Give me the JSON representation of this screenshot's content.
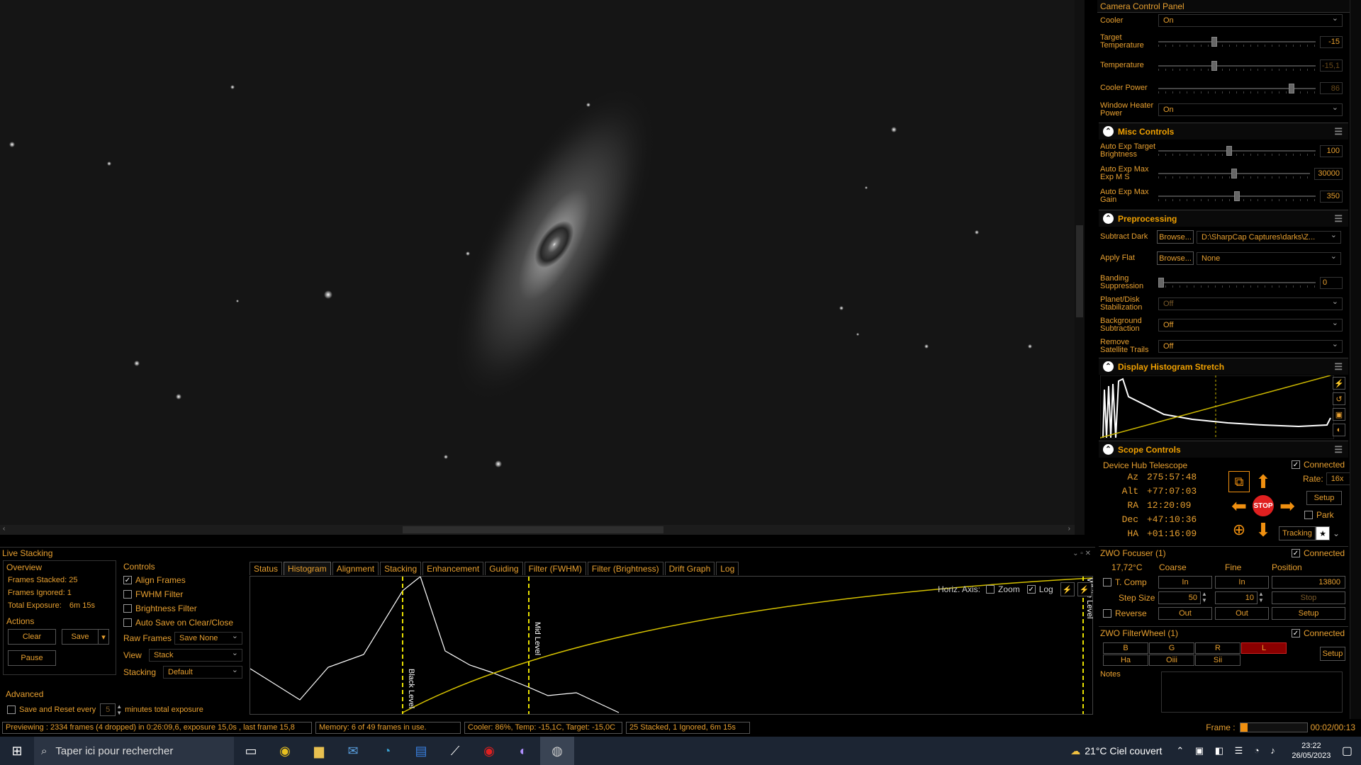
{
  "camera_panel": {
    "title": "Camera Control Panel",
    "cooler": {
      "label": "Cooler",
      "value": "On"
    },
    "target_temperature": {
      "label": "Target Temperature",
      "value": "-15",
      "level": 0.35
    },
    "temperature": {
      "label": "Temperature",
      "value": "-15,1",
      "level": 0.35
    },
    "cooler_power": {
      "label": "Cooler Power",
      "value": "86",
      "level": 0.86
    },
    "window_heater": {
      "label": "Window Heater Power",
      "value": "On"
    }
  },
  "misc_controls": {
    "title": "Misc Controls",
    "auto_exp_target": {
      "label": "Auto Exp Target Brightness",
      "value": "100",
      "level": 0.45
    },
    "auto_exp_max_ms": {
      "label": "Auto Exp Max Exp M S",
      "value": "30000",
      "level": 0.5
    },
    "auto_exp_max_gain": {
      "label": "Auto Exp Max Gain",
      "value": "350",
      "level": 0.5
    }
  },
  "preprocessing": {
    "title": "Preprocessing",
    "subtract_dark": {
      "label": "Subtract Dark",
      "browse": "Browse...",
      "value": "D:\\SharpCap Captures\\darks\\Z..."
    },
    "apply_flat": {
      "label": "Apply Flat",
      "browse": "Browse...",
      "value": "None"
    },
    "banding": {
      "label": "Banding Suppression",
      "value": "0",
      "level": 0.0
    },
    "planet_disk": {
      "label": "Planet/Disk Stabilization",
      "value": "Off"
    },
    "background_sub": {
      "label": "Background Subtraction",
      "value": "Off"
    },
    "remove_trails": {
      "label": "Remove Satellite Trails",
      "value": "Off"
    }
  },
  "histogram_stretch": {
    "title": "Display Histogram Stretch"
  },
  "scope_controls": {
    "title": "Scope Controls",
    "device": "Device Hub Telescope",
    "connected": "Connected",
    "coords": [
      {
        "label": "Az",
        "value": "275:57:48"
      },
      {
        "label": "Alt",
        "value": "+77:07:03"
      },
      {
        "label": "RA",
        "value": "12:20:09"
      },
      {
        "label": "Dec",
        "value": "+47:10:36"
      },
      {
        "label": "HA",
        "value": "+01:16:09"
      }
    ],
    "rate_label": "Rate:",
    "rate": "16x",
    "setup": "Setup",
    "park": "Park",
    "tracking": "Tracking",
    "stop": "STOP"
  },
  "focuser": {
    "title": "ZWO Focuser (1)",
    "connected": "Connected",
    "temp": "17,72°C",
    "coarse": "Coarse",
    "fine": "Fine",
    "position_label": "Position",
    "position": "13800",
    "tcomp": "T. Comp",
    "in": "In",
    "step_size": "Step Size",
    "coarse_step": "50",
    "fine_step": "10",
    "stop": "Stop",
    "reverse": "Reverse",
    "out": "Out",
    "setup": "Setup"
  },
  "filterwheel": {
    "title": "ZWO FilterWheel (1)",
    "connected": "Connected",
    "filters_row1": [
      "B",
      "G",
      "R",
      "L"
    ],
    "filters_row2": [
      "Ha",
      "Oiii",
      "Sii"
    ],
    "selected": "L",
    "setup": "Setup"
  },
  "notes": {
    "label": "Notes"
  },
  "live_stacking": {
    "title": "Live Stacking",
    "overview": {
      "title": "Overview",
      "frames_stacked": "Frames Stacked: 25",
      "frames_ignored": "Frames Ignored: 1",
      "total_exposure_label": "Total Exposure:",
      "total_exposure": "6m 15s"
    },
    "actions": {
      "title": "Actions",
      "clear": "Clear",
      "save": "Save",
      "pause": "Pause"
    },
    "advanced": {
      "title": "Advanced",
      "save_reset": "Save and Reset every",
      "minutes": "5",
      "minutes_suffix": "minutes total exposure"
    },
    "controls": {
      "title": "Controls",
      "align": "Align Frames",
      "fwhm": "FWHM Filter",
      "brightness": "Brightness Filter",
      "autosave": "Auto Save on Clear/Close",
      "raw_frames_label": "Raw Frames",
      "raw_frames": "Save None",
      "view_label": "View",
      "view": "Stack",
      "stacking_label": "Stacking",
      "stacking": "Default"
    },
    "tabs": [
      "Status",
      "Histogram",
      "Alignment",
      "Stacking",
      "Enhancement",
      "Guiding",
      "Filter (FWHM)",
      "Filter (Brightness)",
      "Drift Graph",
      "Log"
    ],
    "active_tab": "Histogram",
    "histogram": {
      "horiz_axis": "Horiz. Axis:",
      "zoom": "Zoom",
      "log": "Log",
      "black_level": "Black Level",
      "mid_level": "Mid Level",
      "white_level": "White Level"
    }
  },
  "status": {
    "previewing": "Previewing : 2334 frames (4 dropped) in 0:26:09,6, exposure 15,0s , last frame 15,8",
    "memory": "Memory: 6 of 49 frames in use.",
    "cooler": "Cooler: 86%, Temp: -15,1C, Target: -15,0C",
    "stacked": "25 Stacked, 1 Ignored, 6m 15s",
    "frame_label": "Frame :",
    "frame_time": "00:02/00:13"
  },
  "taskbar": {
    "search": "Taper ici pour rechercher",
    "weather": "21°C  Ciel couvert",
    "time": "23:22",
    "date": "26/05/2023"
  }
}
